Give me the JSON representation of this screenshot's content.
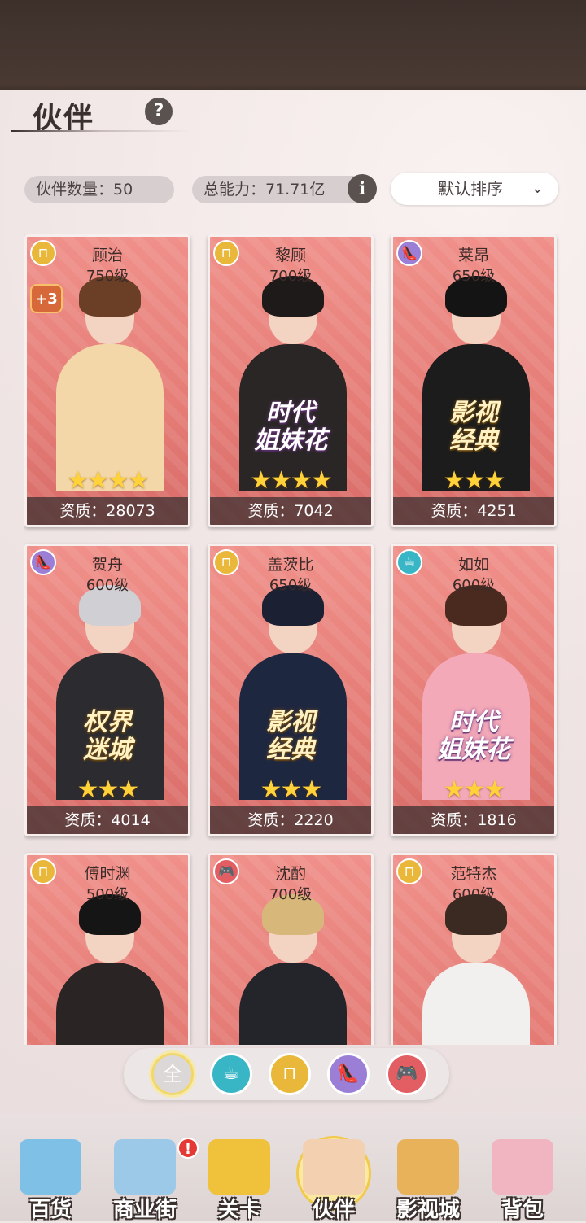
{
  "page": {
    "title": "伙伴",
    "help": "?",
    "partner_count_label": "伙伴数量：50",
    "total_power_label": "总能力：71.71亿",
    "info": "i",
    "sort_label": "默认排序",
    "sort_chevron": "⌄"
  },
  "partners": [
    {
      "name": "顾治",
      "level": "750级",
      "stars": "★★★★",
      "aptitude": "资质：28073",
      "badge": "shop",
      "badge_icon": "shopping-bag-icon",
      "plus": "+3",
      "tag": "",
      "hair": "#6b3e26",
      "outfit": "#f3d7a8"
    },
    {
      "name": "黎顾",
      "level": "700级",
      "stars": "★★★★",
      "aptitude": "资质：7042",
      "badge": "shop",
      "badge_icon": "shopping-bag-icon",
      "plus": "",
      "tag": "时代\n姐妹花",
      "tag_style": "white",
      "hair": "#1e1a1a",
      "outfit": "#2a2626"
    },
    {
      "name": "莱昂",
      "level": "650级",
      "stars": "★★★",
      "aptitude": "资质：4251",
      "badge": "shoe",
      "badge_icon": "high-heel-icon",
      "plus": "",
      "tag": "影视\n经典",
      "tag_style": "gold",
      "hair": "#141414",
      "outfit": "#1c1c1c"
    },
    {
      "name": "贺舟",
      "level": "600级",
      "stars": "★★★",
      "aptitude": "资质：4014",
      "badge": "shoe",
      "badge_icon": "high-heel-icon",
      "plus": "",
      "tag": "权界\n迷城",
      "tag_style": "gold",
      "hair": "#cfcfd4",
      "outfit": "#2b2b30"
    },
    {
      "name": "盖茨比",
      "level": "650级",
      "stars": "★★★",
      "aptitude": "资质：2220",
      "badge": "shop",
      "badge_icon": "shopping-bag-icon",
      "plus": "",
      "tag": "影视\n经典",
      "tag_style": "gold",
      "hair": "#1b2033",
      "outfit": "#1e2740"
    },
    {
      "name": "如如",
      "level": "600级",
      "stars": "★★★",
      "aptitude": "资质：1816",
      "badge": "cup",
      "badge_icon": "coffee-cup-icon",
      "plus": "",
      "tag": "时代\n姐妹花",
      "tag_style": "white",
      "hair": "#4a2a1f",
      "outfit": "#f3a9b8"
    },
    {
      "name": "傅时渊",
      "level": "500级",
      "stars": "",
      "aptitude": "",
      "badge": "shop",
      "badge_icon": "shopping-bag-icon",
      "plus": "",
      "tag": "",
      "hair": "#151515",
      "outfit": "#2a2424"
    },
    {
      "name": "沈酌",
      "level": "700级",
      "stars": "",
      "aptitude": "",
      "badge": "game",
      "badge_icon": "gamepad-icon",
      "plus": "",
      "tag": "",
      "hair": "#d8b77a",
      "outfit": "#23252b"
    },
    {
      "name": "范特杰",
      "level": "600级",
      "stars": "",
      "aptitude": "",
      "badge": "shop",
      "badge_icon": "shopping-bag-icon",
      "plus": "",
      "tag": "",
      "hair": "#3a2a22",
      "outfit": "#f2f0ee"
    }
  ],
  "filters": [
    {
      "key": "all",
      "label": "全",
      "icon": "all-icon",
      "color": "#dcd8d8"
    },
    {
      "key": "cup",
      "label": "☕",
      "icon": "coffee-cup-icon",
      "color": "#39b6c6"
    },
    {
      "key": "shop",
      "label": "⊓",
      "icon": "shopping-bag-icon",
      "color": "#e9b83b"
    },
    {
      "key": "shoe",
      "label": "👠",
      "icon": "high-heel-icon",
      "color": "#9b7fd6"
    },
    {
      "key": "game",
      "label": "🎮",
      "icon": "gamepad-icon",
      "color": "#e35e63"
    }
  ],
  "nav": [
    {
      "label": "百货",
      "icon": "department-store-icon",
      "color": "#7fc0e6"
    },
    {
      "label": "商业街",
      "icon": "commercial-street-icon",
      "color": "#9cc9e8"
    },
    {
      "label": "关卡",
      "icon": "delivery-truck-icon",
      "color": "#f0c23b"
    },
    {
      "label": "伙伴",
      "icon": "partner-icon",
      "color": "#f3d0b0"
    },
    {
      "label": "影视城",
      "icon": "film-camera-icon",
      "color": "#e7b25a"
    },
    {
      "label": "背包",
      "icon": "handbag-icon",
      "color": "#f0b5c0"
    }
  ],
  "nav_alert": "!"
}
